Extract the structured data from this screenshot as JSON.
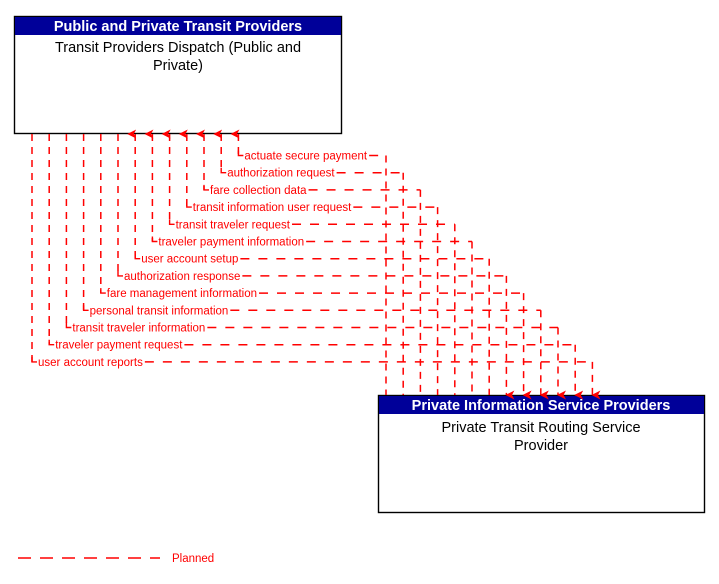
{
  "diagram": {
    "type": "interconnect-flow-diagram",
    "colors": {
      "header_fill": "#000099",
      "header_text": "#ffffff",
      "box_border": "#000000",
      "box_fill": "#ffffff",
      "flow_line": "#ff0000",
      "flow_text": "#ff0000",
      "body_text": "#000000"
    },
    "top_box": {
      "title": "Public and Private Transit Providers",
      "name": "Transit Providers Dispatch (Public and Private)"
    },
    "bottom_box": {
      "title": "Private Information Service Providers",
      "name": "Private Transit Routing Service Provider"
    },
    "flows": [
      {
        "label": "actuate secure payment",
        "direction": "up"
      },
      {
        "label": "authorization request",
        "direction": "up"
      },
      {
        "label": "fare collection data",
        "direction": "up"
      },
      {
        "label": "transit information user request",
        "direction": "up"
      },
      {
        "label": "transit traveler request",
        "direction": "up"
      },
      {
        "label": "traveler payment information",
        "direction": "up"
      },
      {
        "label": "user account setup",
        "direction": "up"
      },
      {
        "label": "authorization response",
        "direction": "down"
      },
      {
        "label": "fare management information",
        "direction": "down"
      },
      {
        "label": "personal transit information",
        "direction": "down"
      },
      {
        "label": "transit traveler information",
        "direction": "down"
      },
      {
        "label": "traveler payment request",
        "direction": "down"
      },
      {
        "label": "user account reports",
        "direction": "down"
      }
    ],
    "legend": [
      {
        "label": "Planned",
        "style": "dashed",
        "color": "#ff0000"
      }
    ]
  }
}
